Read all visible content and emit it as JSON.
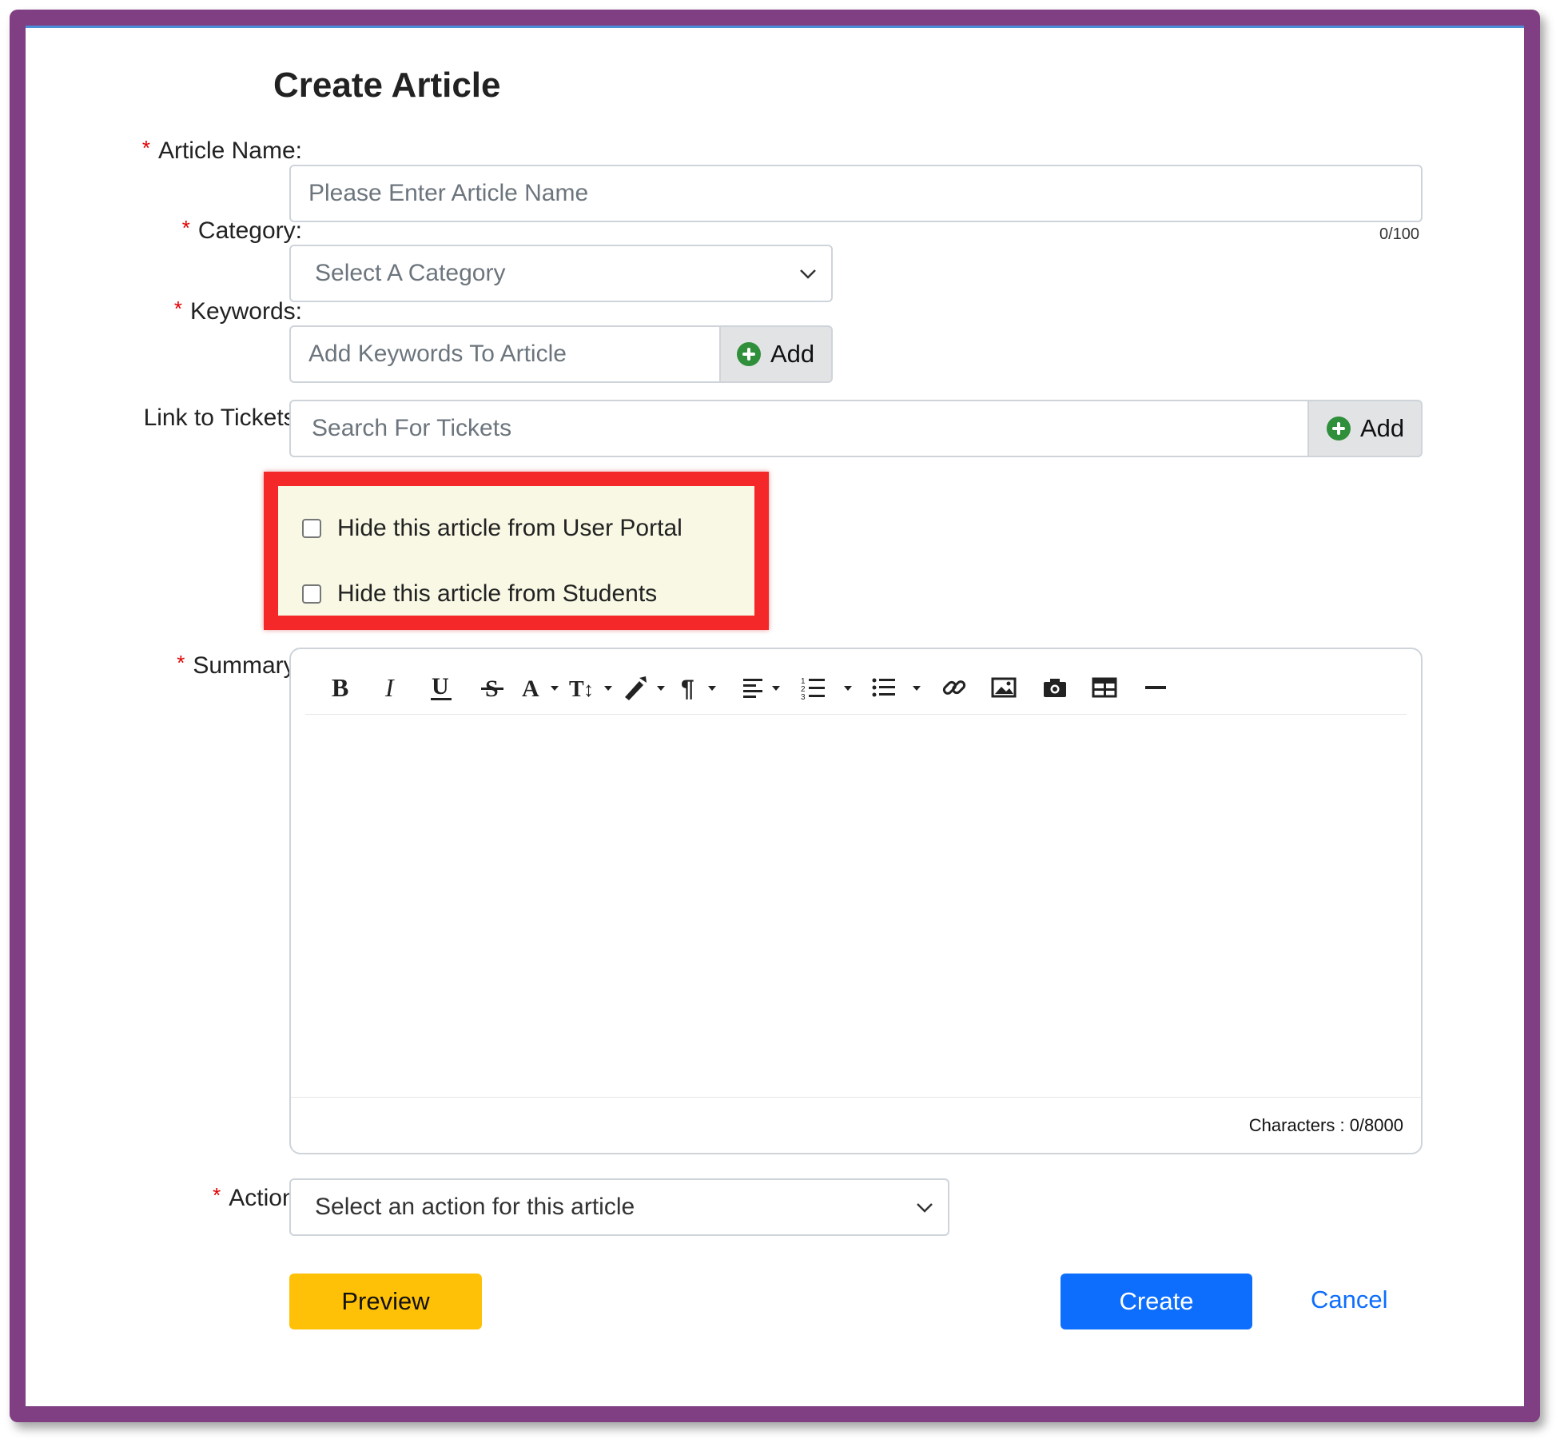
{
  "form": {
    "title": "Create Article",
    "article_name": {
      "label": "Article Name:",
      "placeholder": "Please Enter Article Name",
      "counter": "0/100"
    },
    "category": {
      "label": "Category:",
      "selected": "Select A Category"
    },
    "keywords": {
      "label": "Keywords:",
      "placeholder": "Add Keywords To Article",
      "add_label": "Add"
    },
    "tickets": {
      "label": "Link to Tickets:",
      "placeholder": "Search For Tickets",
      "add_label": "Add"
    },
    "options": [
      {
        "label": "Hide this article from User Portal",
        "checked": false
      },
      {
        "label": "Hide this article from Students",
        "checked": false
      }
    ],
    "summary": {
      "label": "Summary:",
      "char_count": "Characters : 0/8000",
      "toolbar": [
        "bold-icon",
        "italic-icon",
        "underline-icon",
        "strikethrough-icon",
        "font-color-icon",
        "font-size-icon",
        "paint-brush-icon",
        "paragraph-icon",
        "align-icon",
        "ordered-list-icon",
        "unordered-list-icon",
        "link-icon",
        "image-icon",
        "camera-icon",
        "table-icon",
        "horizontal-rule-icon"
      ]
    },
    "action": {
      "label": "Action:",
      "selected": "Select an action for this article"
    },
    "buttons": {
      "preview": "Preview",
      "create": "Create",
      "cancel": "Cancel"
    },
    "required_marker": "*"
  },
  "colors": {
    "frame": "#7f3f82",
    "highlight": "#f42828",
    "primary": "#0d6efd",
    "warning": "#ffc107",
    "required": "#e00000",
    "add_icon": "#2f8f3a"
  }
}
